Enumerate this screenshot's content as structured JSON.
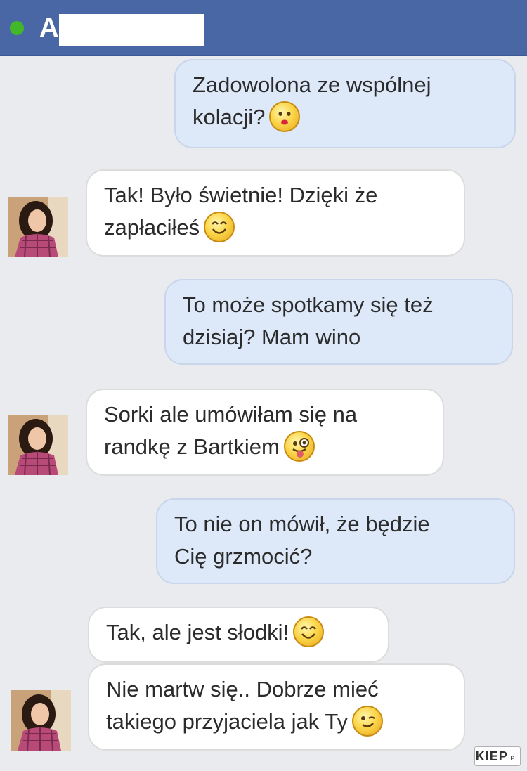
{
  "header": {
    "contact_initial": "A",
    "online_color": "#42b72a",
    "bar_color": "#4a67a5"
  },
  "messages": [
    {
      "side": "sent",
      "lines": [
        "Zadowolona ze wspólnej",
        "kolacji?"
      ],
      "emoji": "kiss-face-icon"
    },
    {
      "side": "received",
      "lines": [
        "Tak! Było świetnie! Dzięki że",
        "zapłaciłeś"
      ],
      "emoji": "smile-face-icon"
    },
    {
      "side": "sent",
      "lines": [
        "To może spotkamy się też",
        "dzisiaj? Mam wino"
      ]
    },
    {
      "side": "received",
      "lines": [
        "Sorki ale umówiłam się na",
        "randkę z Bartkiem"
      ],
      "emoji": "tongue-wink-face-icon"
    },
    {
      "side": "sent",
      "lines": [
        "To nie on mówił, że będzie",
        "Cię grzmocić?"
      ]
    },
    {
      "side": "received",
      "lines": [
        "Tak, ale jest słodki!"
      ],
      "emoji": "smile-face-icon"
    },
    {
      "side": "received",
      "lines": [
        "Nie martw się.. Dobrze mieć",
        "takiego przyjaciela jak Ty"
      ],
      "emoji": "wink-face-icon"
    }
  ],
  "watermark": {
    "main": "KIEP",
    "suffix": ".PL"
  }
}
